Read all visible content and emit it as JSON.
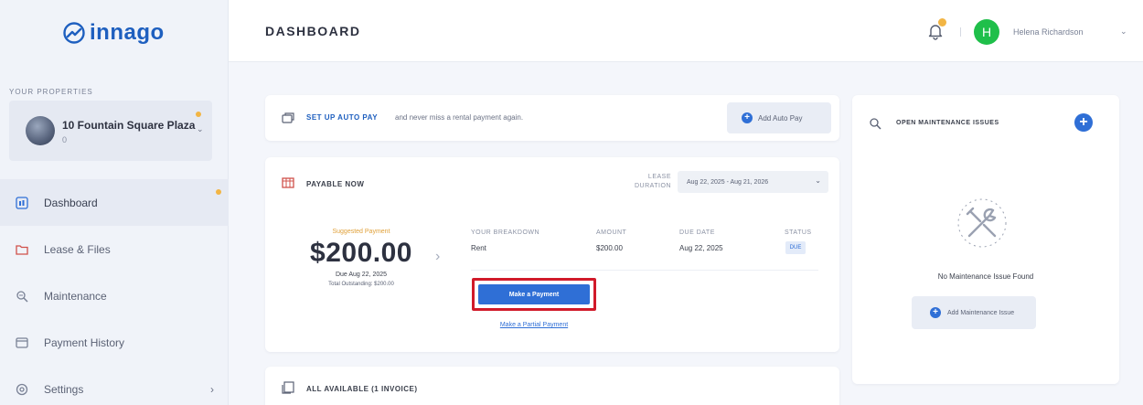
{
  "brand": {
    "name": "innago",
    "color": "#1e5fbf"
  },
  "sidebar": {
    "properties_label": "YOUR PROPERTIES",
    "property": {
      "name": "10 Fountain Square Plaza",
      "sub": "0"
    },
    "nav": [
      {
        "label": "Dashboard",
        "icon": "dashboard-icon",
        "active": true
      },
      {
        "label": "Lease & Files",
        "icon": "folder-icon"
      },
      {
        "label": "Maintenance",
        "icon": "maintenance-icon"
      },
      {
        "label": "Payment History",
        "icon": "payment-history-icon"
      },
      {
        "label": "Settings",
        "icon": "gear-icon",
        "arrow": "›"
      }
    ]
  },
  "header": {
    "title": "DASHBOARD",
    "user": {
      "initial": "H",
      "name": "Helena Richardson",
      "avatar_color": "#1fbf4a"
    }
  },
  "autopay": {
    "title": "SET UP AUTO PAY",
    "text": "and never miss a rental payment again.",
    "button": "Add Auto Pay"
  },
  "payable": {
    "title": "PAYABLE NOW",
    "lease_label_1": "LEASE",
    "lease_label_2": "DURATION",
    "lease_range": "Aug 22, 2025 - Aug 21, 2026",
    "suggested_label": "Suggested Payment",
    "amount": "$200.00",
    "due": "Due Aug 22, 2025",
    "total_outstanding": "Total Outstanding: $200.00",
    "columns": {
      "breakdown": "YOUR BREAKDOWN",
      "amount": "AMOUNT",
      "due_date": "DUE DATE",
      "status": "STATUS"
    },
    "row": {
      "breakdown": "Rent",
      "amount": "$200.00",
      "due_date": "Aug 22, 2025",
      "status": "DUE"
    },
    "make_payment": "Make a Payment",
    "partial_payment": "Make a Partial Payment"
  },
  "invoices": {
    "title": "ALL AVAILABLE (1 INVOICE)"
  },
  "maintenance": {
    "title": "OPEN MAINTENANCE ISSUES",
    "empty_text": "No Maintenance Issue Found",
    "button": "Add Maintenance Issue"
  },
  "colors": {
    "accent": "#2f6fd6",
    "highlight": "#d11a2a",
    "notice": "#f2b544"
  }
}
